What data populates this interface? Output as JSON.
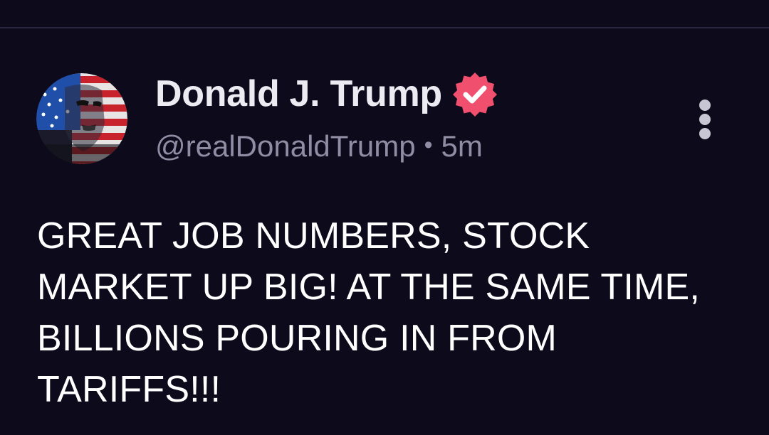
{
  "post": {
    "author": {
      "display_name": "Donald J. Trump",
      "handle": "@realDonaldTrump",
      "verified": true,
      "avatar_icon": "flag-portrait-avatar"
    },
    "separator": "•",
    "timestamp": "5m",
    "text": "GREAT JOB NUMBERS, STOCK MARKET UP BIG! AT THE SAME TIME, BILLIONS POURING IN FROM TARIFFS!!!",
    "more_icon": "vertical-ellipsis-icon"
  },
  "colors": {
    "background": "#0d0a1c",
    "verified_badge": "#f0506e",
    "display_name": "#ecebf2",
    "meta_text": "#8f8ca3",
    "body_text": "#ffffff"
  }
}
